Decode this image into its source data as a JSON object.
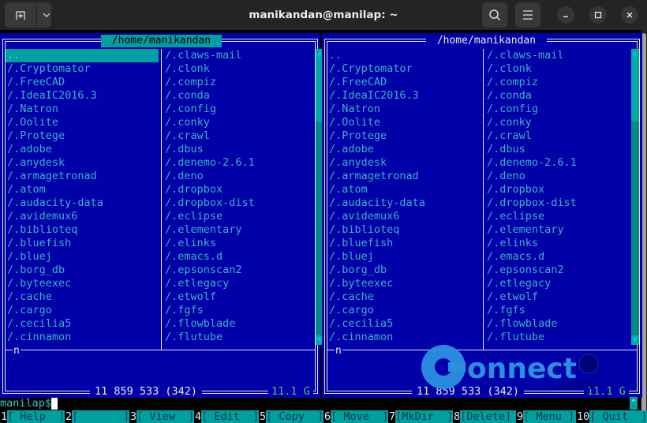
{
  "window": {
    "title": "manikandan@manilap: ~",
    "buttons": {
      "new_tab": "new-tab-icon",
      "dropdown": "chevron-down-icon",
      "search": "search-icon",
      "menu": "hamburger-icon",
      "minimize": "minimize-icon",
      "maximize": "maximize-icon",
      "close": "close-icon"
    }
  },
  "left_panel": {
    "path": " /home/manikandan ",
    "selected_index": 0,
    "column1": [
      "..",
      "/.Cryptomator",
      "/.FreeCAD",
      "/.IdeaIC2016.3",
      "/.Natron",
      "/.Oolite",
      "/.Protege",
      "/.adobe",
      "/.anydesk",
      "/.armagetronad",
      "/.atom",
      "/.audacity-data",
      "/.avidemux6",
      "/.biblioteq",
      "/.bluefish",
      "/.bluej",
      "/.borg_db",
      "/.byteexec",
      "/.cache",
      "/.cargo",
      "/.cecilia5",
      "/.cinnamon"
    ],
    "column2": [
      "/.claws-mail",
      "/.clonk",
      "/.compiz",
      "/.conda",
      "/.config",
      "/.conky",
      "/.crawl",
      "/.dbus",
      "/.denemo-2.6.1",
      "/.deno",
      "/.dropbox",
      "/.dropbox-dist",
      "/.eclipse",
      "/.elementary",
      "/.elinks",
      "/.emacs.d",
      "/.epsonscan2",
      "/.etlegacy",
      "/.etwolf",
      "/.fgfs",
      "/.flowblade",
      "/.flutube"
    ],
    "mini_status": "n",
    "info": "11 859 533 (342)",
    "free_space": "11.1 G"
  },
  "right_panel": {
    "path": " /home/manikandan ",
    "column1": [
      "..",
      "/.Cryptomator",
      "/.FreeCAD",
      "/.IdeaIC2016.3",
      "/.Natron",
      "/.Oolite",
      "/.Protege",
      "/.adobe",
      "/.anydesk",
      "/.armagetronad",
      "/.atom",
      "/.audacity-data",
      "/.avidemux6",
      "/.biblioteq",
      "/.bluefish",
      "/.bluej",
      "/.borg_db",
      "/.byteexec",
      "/.cache",
      "/.cargo",
      "/.cecilia5",
      "/.cinnamon"
    ],
    "column2": [
      "/.claws-mail",
      "/.clonk",
      "/.compiz",
      "/.conda",
      "/.config",
      "/.conky",
      "/.crawl",
      "/.dbus",
      "/.denemo-2.6.1",
      "/.deno",
      "/.dropbox",
      "/.dropbox-dist",
      "/.eclipse",
      "/.elementary",
      "/.elinks",
      "/.emacs.d",
      "/.epsonscan2",
      "/.etlegacy",
      "/.etwolf",
      "/.fgfs",
      "/.flowblade",
      "/.flutube"
    ],
    "mini_status": "n",
    "info": "11 859 533 (342)",
    "free_space": "11.1 G"
  },
  "command_line": {
    "prompt": "manilap$",
    "value": ""
  },
  "hint_caret": "^",
  "function_keys": [
    {
      "num": "1",
      "label": "[ Help  ]"
    },
    {
      "num": "2",
      "label": "[       ]"
    },
    {
      "num": "3",
      "label": "[ View  ]"
    },
    {
      "num": "4",
      "label": "[ Edit  ]"
    },
    {
      "num": "5",
      "label": "[ Copy  ]"
    },
    {
      "num": "6",
      "label": "[ Move  ]"
    },
    {
      "num": "7",
      "label": "[MkDir  ]"
    },
    {
      "num": "8",
      "label": "[Delete]"
    },
    {
      "num": "9",
      "label": "[ Menu ]"
    },
    {
      "num": "10",
      "label": "[ Quit  ]"
    }
  ],
  "watermark": {
    "text": "onnect",
    "suffix": ".com",
    "color": "#2a8fe0"
  },
  "colors": {
    "panel_bg": "#0000a8",
    "selection": "#00a0a0",
    "file_text": "#39b2c4",
    "free_space": "#4ec26a"
  }
}
